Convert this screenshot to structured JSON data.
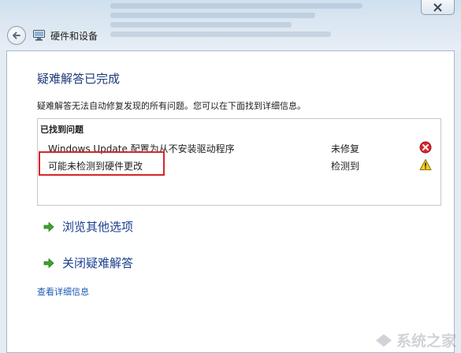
{
  "window": {
    "title": "硬件和设备",
    "close_icon": "close-icon",
    "back_icon": "back-arrow-icon"
  },
  "main": {
    "heading": "疑难解答已完成",
    "summary": "疑难解答无法自动修复发现的所有问题。您可以在下面找到详细信息。",
    "problems_header": "已找到问题",
    "problems": [
      {
        "name": "Windows Update 配置为从不安装驱动程序",
        "status": "未修复",
        "icon": "error-icon"
      },
      {
        "name": "可能未检测到硬件更改",
        "status": "检测到",
        "icon": "warning-icon"
      }
    ],
    "options": [
      {
        "label": "浏览其他选项",
        "icon": "green-arrow-icon"
      },
      {
        "label": "关闭疑难解答",
        "icon": "green-arrow-icon"
      }
    ],
    "details_link": "查看详细信息"
  },
  "colors": {
    "heading": "#1d3a78",
    "link": "#1b59b3",
    "highlight": "#d6262b"
  }
}
